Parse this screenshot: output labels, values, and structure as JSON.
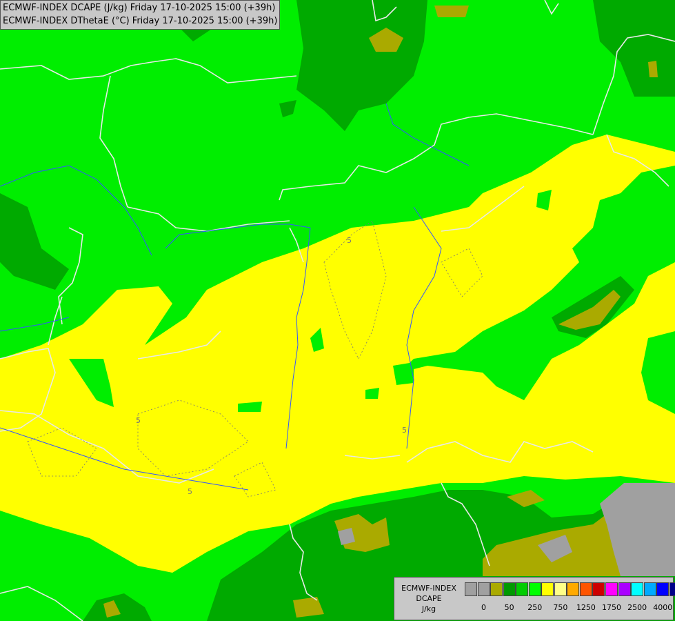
{
  "title": {
    "line1": "ECMWF-INDEX DCAPE (J/kg) Friday 17-10-2025 15:00 (+39h)",
    "line2": "ECMWF-INDEX DThetaE (°C) Friday 17-10-2025 15:00 (+39h)"
  },
  "legend": {
    "model": "ECMWF-INDEX",
    "variable": "DCAPE",
    "unit": "J/kg",
    "colors": [
      "#a0a0a0",
      "#a0a0a0",
      "#aaaa00",
      "#009900",
      "#00cc00",
      "#00ff00",
      "#ffff00",
      "#ffff88",
      "#ffaa00",
      "#ff5500",
      "#cc0000",
      "#ff00ff",
      "#aa00ff",
      "#00ffff",
      "#00aaff",
      "#0000ff",
      "#000088"
    ],
    "tick_labels": [
      "0",
      "50",
      "250",
      "750",
      "1250",
      "1750",
      "2500",
      "4000"
    ]
  },
  "contour_labels": [
    "5",
    "5",
    "5",
    "5"
  ],
  "palette": {
    "light_green": "#00ee00",
    "dark_green": "#00aa00",
    "yellow": "#ffff00",
    "olive": "#aaaa00",
    "gray": "#a0a0a0",
    "border_white": "#e8e8e8",
    "river_blue": "#3355ff"
  }
}
